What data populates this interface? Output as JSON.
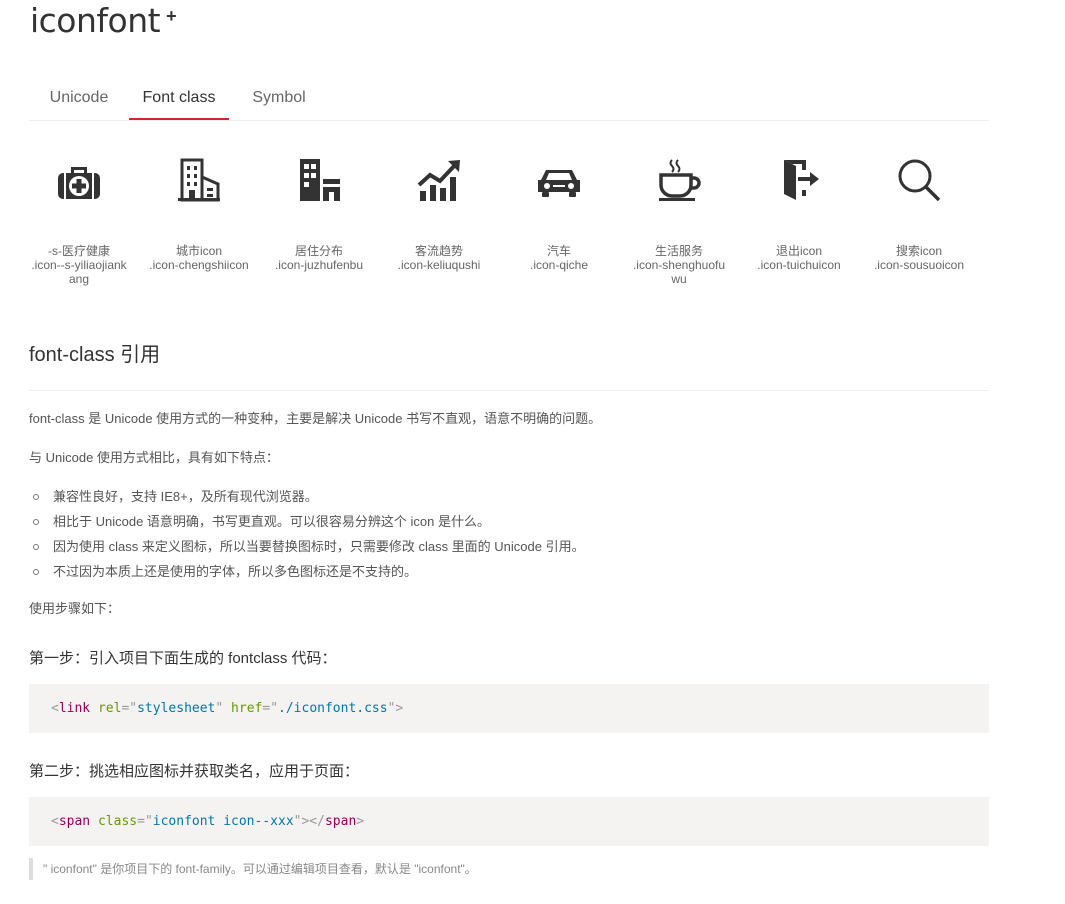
{
  "logo": {
    "text": "iconfont",
    "plus": "+"
  },
  "tabs": [
    {
      "label": "Unicode",
      "active": false
    },
    {
      "label": "Font class",
      "active": true
    },
    {
      "label": "Symbol",
      "active": false
    }
  ],
  "icons": [
    {
      "name": "-s-医疗健康",
      "code": ".icon--s-yiliaojiankang",
      "icon": "medical-kit-icon"
    },
    {
      "name": "城市icon",
      "code": ".icon-chengshiicon",
      "icon": "city-buildings-icon"
    },
    {
      "name": "居住分布",
      "code": ".icon-juzhufenbu",
      "icon": "residence-icon"
    },
    {
      "name": "客流趋势",
      "code": ".icon-keliuqushi",
      "icon": "trend-chart-icon"
    },
    {
      "name": "汽车",
      "code": ".icon-qiche",
      "icon": "car-icon"
    },
    {
      "name": "生活服务",
      "code": ".icon-shenghuofuwu",
      "icon": "coffee-cup-icon"
    },
    {
      "name": "退出icon",
      "code": ".icon-tuichuicon",
      "icon": "exit-door-icon"
    },
    {
      "name": "搜索icon",
      "code": ".icon-sousuoicon",
      "icon": "search-icon"
    }
  ],
  "content": {
    "heading": "font-class 引用",
    "intro": "font-class 是 Unicode 使用方式的一种变种，主要是解决 Unicode 书写不直观，语意不明确的问题。",
    "compare": "与 Unicode 使用方式相比，具有如下特点：",
    "features": [
      "兼容性良好，支持 IE8+，及所有现代浏览器。",
      "相比于 Unicode 语意明确，书写更直观。可以很容易分辨这个 icon 是什么。",
      "因为使用 class 来定义图标，所以当要替换图标时，只需要修改 class 里面的 Unicode 引用。",
      "不过因为本质上还是使用的字体，所以多色图标还是不支持的。"
    ],
    "steps_intro": "使用步骤如下：",
    "step1": "第一步：引入项目下面生成的 fontclass 代码：",
    "code1": {
      "tag": "link",
      "attr1": "rel",
      "val1": "stylesheet",
      "attr2": "href",
      "val2": "./iconfont.css"
    },
    "step2": "第二步：挑选相应图标并获取类名，应用于页面：",
    "code2": {
      "tag": "span",
      "attr1": "class",
      "val1": "iconfont icon--xxx",
      "close": "span"
    },
    "note": "\" iconfont\" 是你项目下的 font-family。可以通过编辑项目查看，默认是 \"iconfont\"。"
  }
}
